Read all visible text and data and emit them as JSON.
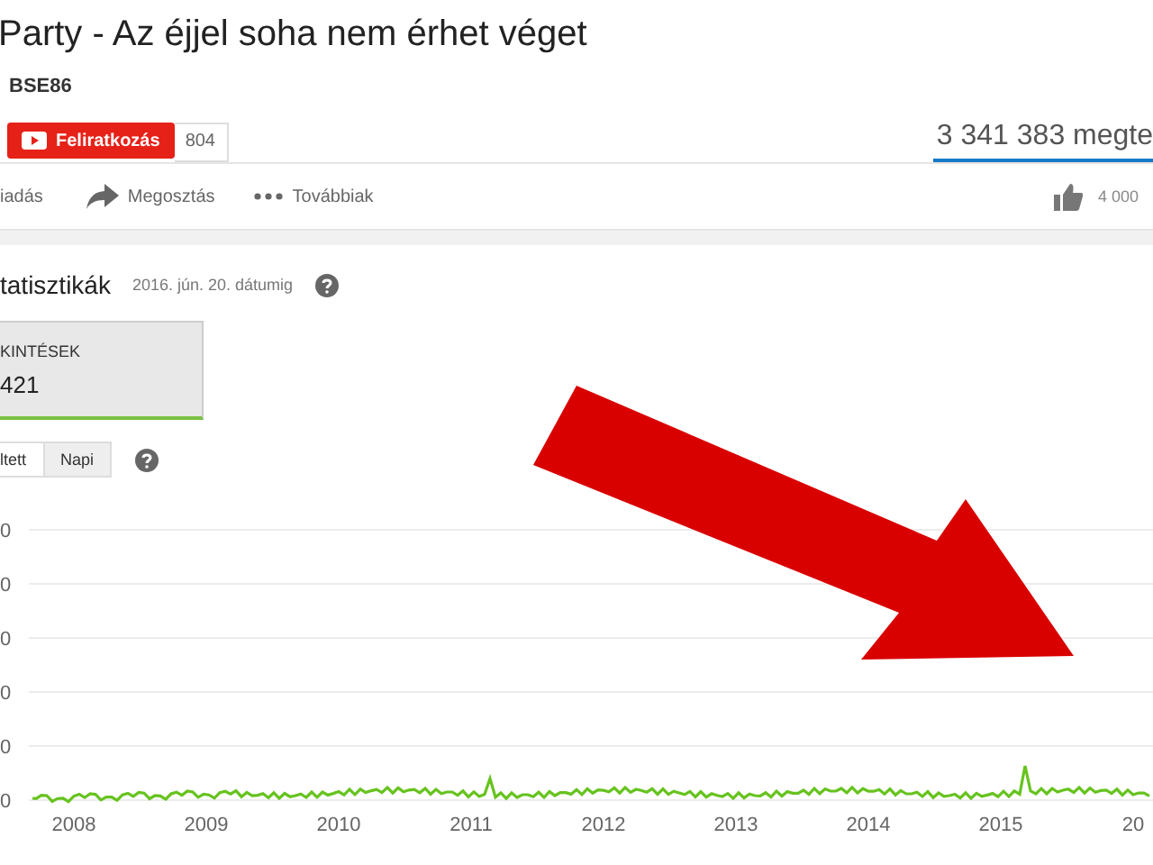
{
  "video": {
    "title": "Party - Az éjjel soha nem érhet véget",
    "channel": "BSE86",
    "subscribe_label": "Feliratkozás",
    "subscriber_count": "804",
    "views": "3 341 383 megte"
  },
  "actions": [
    {
      "kind": "text",
      "label": "iadás"
    },
    {
      "kind": "share",
      "label": "Megosztás"
    },
    {
      "kind": "more",
      "label": "Továbbiak"
    }
  ],
  "likes": "4 000",
  "statistics": {
    "title": "tatisztikák",
    "date": "2016. jún. 20. dátumig",
    "metric_label": "KINTÉSEK",
    "metric_value": "421"
  },
  "toggles": [
    {
      "label": "ltett",
      "selected": false
    },
    {
      "label": "Napi",
      "selected": true
    }
  ],
  "chart": {
    "y_tick_labels": [
      "0",
      "0",
      "0",
      "0",
      "0",
      "0"
    ],
    "x_labels": [
      "2008",
      "2009",
      "2010",
      "2011",
      "2012",
      "2013",
      "2014",
      "2015",
      "20"
    ]
  }
}
